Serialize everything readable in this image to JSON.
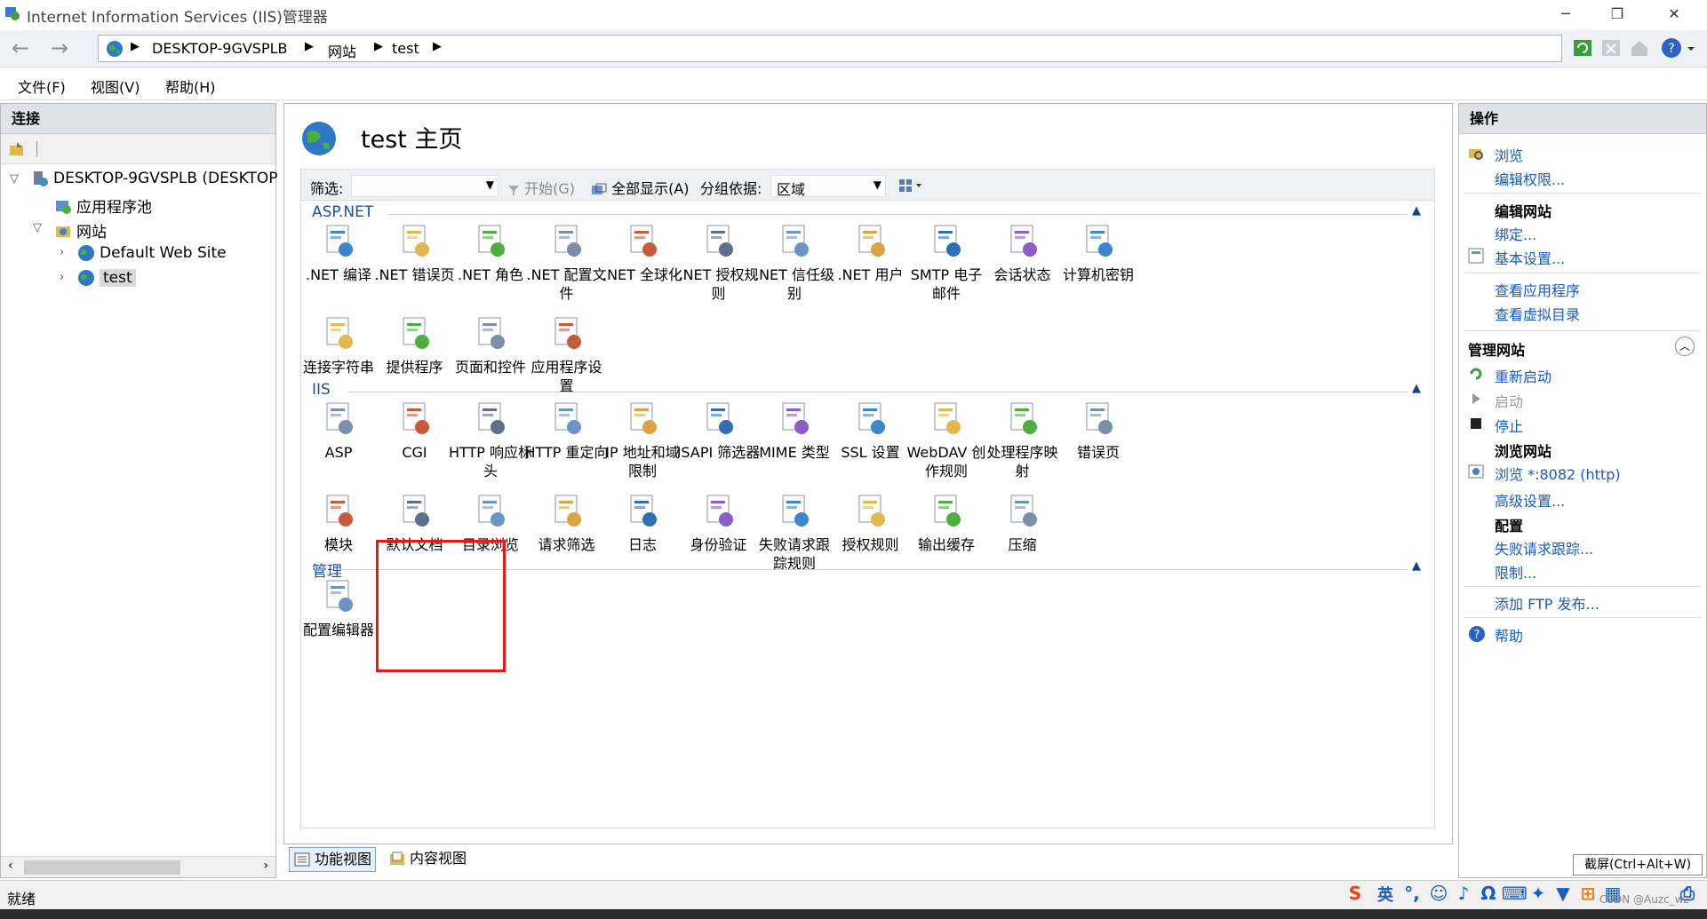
{
  "window": {
    "title": "Internet Information Services (IIS)管理器",
    "minimize": "─",
    "restore": "❐",
    "close": "✕"
  },
  "address": {
    "crumbs": [
      "DESKTOP-9GVSPLB",
      "网站",
      "test"
    ],
    "sep": "▶"
  },
  "menu": [
    "文件(F)",
    "视图(V)",
    "帮助(H)"
  ],
  "left": {
    "header": "连接",
    "tree": [
      {
        "label": "DESKTOP-9GVSPLB (DESKTOP",
        "icon": "server-icon"
      },
      {
        "label": "应用程序池",
        "icon": "app-pool-icon"
      },
      {
        "label": "网站",
        "icon": "sites-folder-icon"
      },
      {
        "label": "Default Web Site",
        "icon": "globe-icon"
      },
      {
        "label": "test",
        "icon": "globe-icon"
      }
    ]
  },
  "center": {
    "title": "test 主页",
    "filter": {
      "label": "筛选:",
      "start": "开始(G)",
      "showall": "全部显示(A)",
      "groupby": "分组依据:",
      "groupvalue": "区域"
    },
    "groups": [
      {
        "title": "ASP.NET",
        "items": [
          ".NET 编译",
          ".NET 错误页",
          ".NET 角色",
          ".NET 配置文\n件",
          ".NET 全球化",
          ".NET 授权规\n则",
          ".NET 信任级\n别",
          ".NET 用户",
          "SMTP 电子\n邮件",
          "会话状态",
          "计算机密钥",
          "连接字符串",
          "提供程序",
          "页面和控件",
          "应用程序设\n置"
        ]
      },
      {
        "title": "IIS",
        "items": [
          "ASP",
          "CGI",
          "HTTP 响应标\n头",
          "HTTP 重定向",
          "IP 地址和域\n限制",
          "ISAPI 筛选器",
          "MIME 类型",
          "SSL 设置",
          "WebDAV 创\n作规则",
          "处理程序映\n射",
          "错误页",
          "模块",
          "默认文档",
          "目录浏览",
          "请求筛选",
          "日志",
          "身份验证",
          "失败请求跟\n踪规则",
          "授权规则",
          "输出缓存",
          "压缩"
        ]
      },
      {
        "title": "管理",
        "items": [
          "配置编辑器"
        ]
      }
    ],
    "views": [
      "功能视图",
      "内容视图"
    ]
  },
  "right": {
    "header": "操作",
    "browse": "浏览",
    "editperm": "编辑权限...",
    "editsite": "编辑网站",
    "bind": "绑定...",
    "basic": "基本设置...",
    "viewapps": "查看应用程序",
    "viewvdirs": "查看虚拟目录",
    "managesite": "管理网站",
    "restart": "重新启动",
    "start": "启动",
    "stop": "停止",
    "browsesite": "浏览网站",
    "browseport": "浏览 *:8082 (http)",
    "advanced": "高级设置...",
    "config": "配置",
    "failtrace": "失败请求跟踪...",
    "limits": "限制...",
    "ftp": "添加 FTP 发布...",
    "help": "帮助"
  },
  "status": {
    "text": "就绪",
    "shot": "截屏(Ctrl+Alt+W)",
    "wm": "CSDN @Auzc_wz",
    "ime": "英"
  },
  "colors": {
    "link": "#1a5bbf",
    "group": "#1f4ea8",
    "highlight": "#e81818"
  }
}
